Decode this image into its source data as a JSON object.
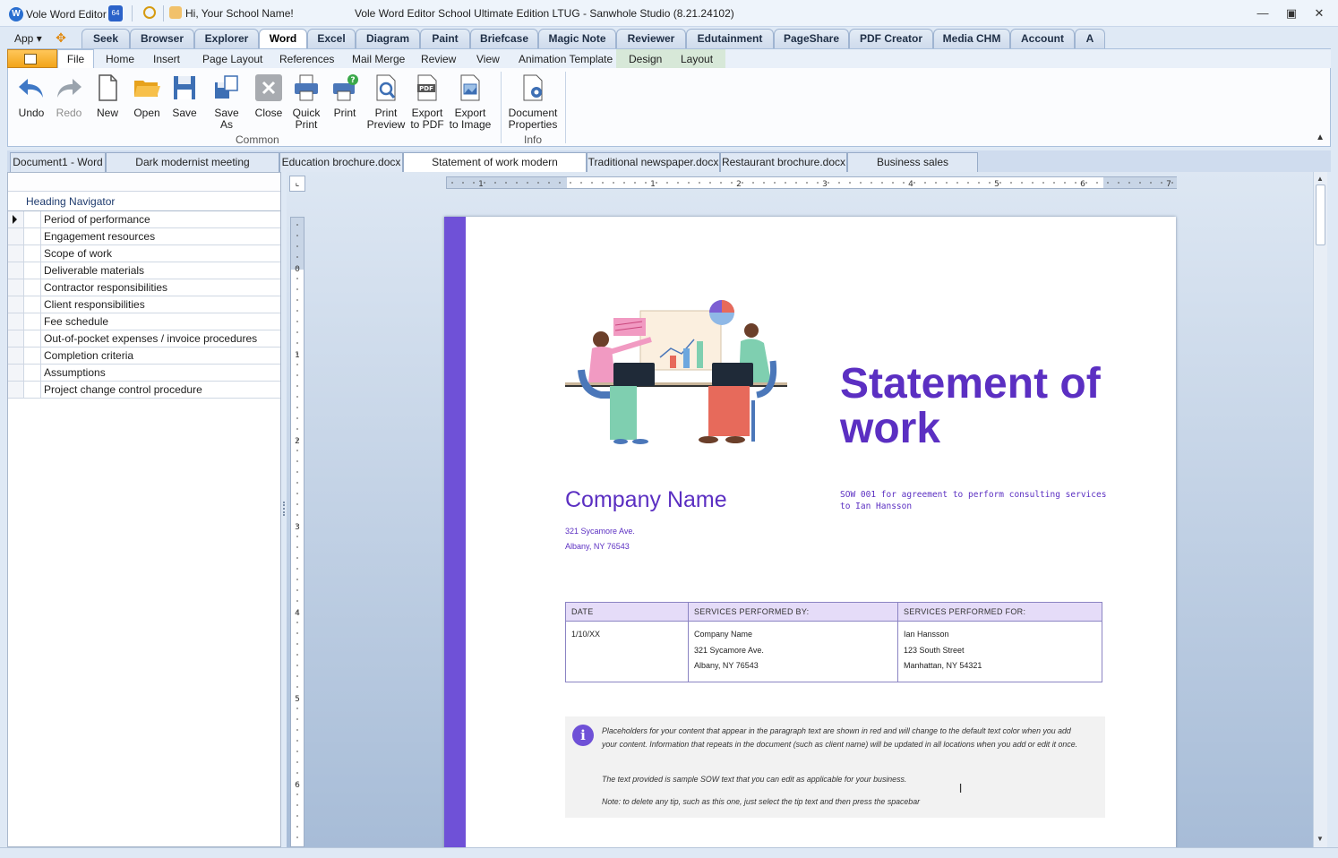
{
  "titlebar": {
    "app_name": "Vole Word Editor",
    "badge": "64",
    "greeting": "Hi, Your School Name!",
    "window_title": "Vole Word Editor School Ultimate Edition LTUG - Sanwhole Studio (8.21.24102)"
  },
  "app_menu": "App",
  "app_tabs": [
    "Seek",
    "Browser",
    "Explorer",
    "Word",
    "Excel",
    "Diagram",
    "Paint",
    "Briefcase",
    "Magic Note",
    "Reviewer",
    "Edutainment",
    "PageShare",
    "PDF Creator",
    "Media CHM",
    "Account",
    "A"
  ],
  "active_app_tab": "Word",
  "ribbon_tabs": {
    "file": "File",
    "home": "Home",
    "insert": "Insert",
    "page_layout": "Page Layout",
    "references": "References",
    "mail_merge": "Mail Merge",
    "review": "Review",
    "view": "View",
    "animation_template": "Animation Template",
    "design": "Design",
    "layout": "Layout"
  },
  "ribbon": {
    "undo": "Undo",
    "redo": "Redo",
    "new": "New",
    "open": "Open",
    "save": "Save",
    "save_as": "Save As",
    "close": "Close",
    "quick_print_1": "Quick",
    "quick_print_2": "Print",
    "print": "Print",
    "print_preview_1": "Print",
    "print_preview_2": "Preview",
    "export_pdf_1": "Export",
    "export_pdf_2": "to PDF",
    "export_image_1": "Export",
    "export_image_2": "to Image",
    "doc_props_1": "Document",
    "doc_props_2": "Properties",
    "group_common": "Common",
    "group_info": "Info"
  },
  "doc_tabs": [
    "Document1 - Word",
    "Dark modernist meeting agenda.docx",
    "Education brochure.docx",
    "Statement of work modern design.docx",
    "Traditional newspaper.docx",
    "Restaurant brochure.docx",
    "Business sales invoice.docx"
  ],
  "active_doc_tab": "Statement of work modern design.docx",
  "navigator": {
    "header": "Heading Navigator",
    "items": [
      "Period of performance",
      "Engagement resources",
      "Scope of work",
      "Deliverable materials",
      "Contractor responsibilities",
      "Client responsibilities",
      "Fee schedule",
      "Out-of-pocket expenses / invoice procedures",
      "Completion criteria",
      "Assumptions",
      "Project change control procedure"
    ]
  },
  "ruler": {
    "h_numbers": [
      "1",
      "1",
      "2",
      "3",
      "4",
      "5",
      "6",
      "7"
    ],
    "v_numbers": [
      "0",
      "1",
      "2",
      "3",
      "4",
      "5",
      "6"
    ]
  },
  "document": {
    "title_line1": "Statement of",
    "title_line2": "work",
    "company_name": "Company Name",
    "address_line1": "321 Sycamore Ave.",
    "address_line2": "Albany, NY 76543",
    "sow_text": "SOW 001 for agreement to perform consulting services to Ian Hansson",
    "table": {
      "headers": [
        "DATE",
        "SERVICES PERFORMED BY:",
        "SERVICES PERFORMED FOR:"
      ],
      "date": "1/10/XX",
      "by": [
        "Company Name",
        "321 Sycamore Ave.",
        "Albany, NY 76543"
      ],
      "for": [
        "Ian Hansson",
        "123 South Street",
        "Manhattan, NY 54321"
      ]
    },
    "tip_icon": "i",
    "tip_p1": "Placeholders for your content that appear in the paragraph text are shown in red and will change to the default text color when you add your content. Information that repeats in the document (such as client name) will be updated in all locations when you add or edit it once.",
    "tip_p2": "The text provided is sample SOW text that you can edit as applicable for your business.",
    "tip_p3": "Note: to delete any tip, such as this one, just select the tip text and then press the spacebar"
  },
  "colors": {
    "accent_purple": "#5b2fc2",
    "sidebar_purple": "#6f51d7",
    "ribbon_orange": "#f2a419"
  },
  "icons": {
    "undo": "undo-arrow-icon",
    "redo": "redo-arrow-icon",
    "new": "blank-document-icon",
    "open": "folder-icon",
    "save": "floppy-disk-icon",
    "save_as": "save-as-icon",
    "close": "close-x-icon",
    "quick_print": "printer-icon",
    "print": "printer-help-icon",
    "print_preview": "magnifier-document-icon",
    "export_pdf": "pdf-document-icon",
    "export_image": "image-document-icon",
    "document_properties": "document-gear-icon"
  }
}
